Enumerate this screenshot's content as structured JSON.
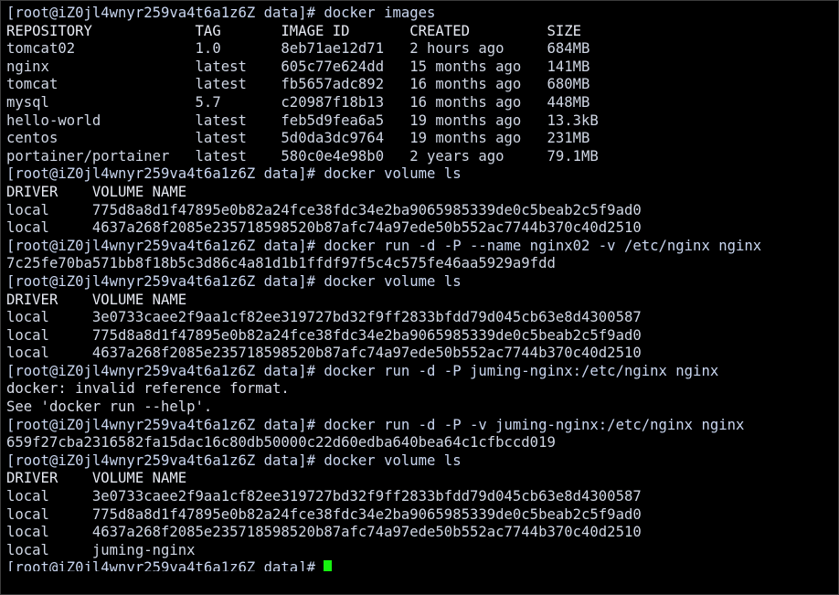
{
  "terminal": {
    "window_title": "root@iZ0jl4wnyr259va4t6a1z6Z:/data",
    "shell_prompt": "[root@iZ0jl4wnyr259va4t6a1z6Z data]# ",
    "background_color": "#000000",
    "foreground_color": "#d8dce8",
    "cursor_color": "#16f110",
    "cursor_glyph": " ",
    "lines": [
      {
        "id": "l01",
        "kind": "prompt",
        "text": "[root@iZ0jl4wnyr259va4t6a1z6Z data]# docker images"
      },
      {
        "id": "l02",
        "kind": "header",
        "text": "REPOSITORY            TAG       IMAGE ID       CREATED         SIZE"
      },
      {
        "id": "l03",
        "kind": "output",
        "text": "tomcat02              1.0       8eb71ae12d71   2 hours ago     684MB"
      },
      {
        "id": "l04",
        "kind": "output",
        "text": "nginx                 latest    605c77e624dd   15 months ago   141MB"
      },
      {
        "id": "l05",
        "kind": "output",
        "text": "tomcat                latest    fb5657adc892   16 months ago   680MB"
      },
      {
        "id": "l06",
        "kind": "output",
        "text": "mysql                 5.7       c20987f18b13   16 months ago   448MB"
      },
      {
        "id": "l07",
        "kind": "output",
        "text": "hello-world           latest    feb5d9fea6a5   19 months ago   13.3kB"
      },
      {
        "id": "l08",
        "kind": "output",
        "text": "centos                latest    5d0da3dc9764   19 months ago   231MB"
      },
      {
        "id": "l09",
        "kind": "output",
        "text": "portainer/portainer   latest    580c0e4e98b0   2 years ago     79.1MB"
      },
      {
        "id": "l10",
        "kind": "prompt",
        "text": "[root@iZ0jl4wnyr259va4t6a1z6Z data]# docker volume ls"
      },
      {
        "id": "l11",
        "kind": "header",
        "text": "DRIVER    VOLUME NAME"
      },
      {
        "id": "l12",
        "kind": "output",
        "text": "local     775d8a8d1f47895e0b82a24fce38fdc34e2ba9065985339de0c5beab2c5f9ad0"
      },
      {
        "id": "l13",
        "kind": "output",
        "text": "local     4637a268f2085e235718598520b87afc74a97ede50b552ac7744b370c40d2510"
      },
      {
        "id": "l14",
        "kind": "prompt",
        "text": "[root@iZ0jl4wnyr259va4t6a1z6Z data]# docker run -d -P --name nginx02 -v /etc/nginx nginx"
      },
      {
        "id": "l15",
        "kind": "output",
        "text": "7c25fe70ba571bb8f18b5c3d86c4a81d1b1ffdf97f5c4c575fe46aa5929a9fdd"
      },
      {
        "id": "l16",
        "kind": "prompt",
        "text": "[root@iZ0jl4wnyr259va4t6a1z6Z data]# docker volume ls"
      },
      {
        "id": "l17",
        "kind": "header",
        "text": "DRIVER    VOLUME NAME"
      },
      {
        "id": "l18",
        "kind": "output",
        "text": "local     3e0733caee2f9aa1cf82ee319727bd32f9ff2833bfdd79d045cb63e8d4300587"
      },
      {
        "id": "l19",
        "kind": "output",
        "text": "local     775d8a8d1f47895e0b82a24fce38fdc34e2ba9065985339de0c5beab2c5f9ad0"
      },
      {
        "id": "l20",
        "kind": "output",
        "text": "local     4637a268f2085e235718598520b87afc74a97ede50b552ac7744b370c40d2510"
      },
      {
        "id": "l21",
        "kind": "prompt",
        "text": "[root@iZ0jl4wnyr259va4t6a1z6Z data]# docker run -d -P juming-nginx:/etc/nginx nginx"
      },
      {
        "id": "l22",
        "kind": "error",
        "text": "docker: invalid reference format."
      },
      {
        "id": "l23",
        "kind": "error",
        "text": "See 'docker run --help'."
      },
      {
        "id": "l24",
        "kind": "prompt",
        "text": "[root@iZ0jl4wnyr259va4t6a1z6Z data]# docker run -d -P -v juming-nginx:/etc/nginx nginx"
      },
      {
        "id": "l25",
        "kind": "output",
        "text": "659f27cba2316582fa15dac16c80db50000c22d60edba640bea64c1cfbccd019"
      },
      {
        "id": "l26",
        "kind": "prompt",
        "text": "[root@iZ0jl4wnyr259va4t6a1z6Z data]# docker volume ls"
      },
      {
        "id": "l27",
        "kind": "header",
        "text": "DRIVER    VOLUME NAME"
      },
      {
        "id": "l28",
        "kind": "output",
        "text": "local     3e0733caee2f9aa1cf82ee319727bd32f9ff2833bfdd79d045cb63e8d4300587"
      },
      {
        "id": "l29",
        "kind": "output",
        "text": "local     775d8a8d1f47895e0b82a24fce38fdc34e2ba9065985339de0c5beab2c5f9ad0"
      },
      {
        "id": "l30",
        "kind": "output",
        "text": "local     4637a268f2085e235718598520b87afc74a97ede50b552ac7744b370c40d2510"
      },
      {
        "id": "l31",
        "kind": "output",
        "text": "local     juming-nginx"
      }
    ],
    "active_prompt": "[root@iZ0jl4wnyr259va4t6a1z6Z data]# ",
    "commands_entered": [
      "docker images",
      "docker volume ls",
      "docker run -d -P --name nginx02 -v /etc/nginx nginx",
      "docker volume ls",
      "docker run -d -P juming-nginx:/etc/nginx nginx",
      "docker run -d -P -v juming-nginx:/etc/nginx nginx",
      "docker volume ls"
    ],
    "images_table": {
      "columns": [
        "REPOSITORY",
        "TAG",
        "IMAGE ID",
        "CREATED",
        "SIZE"
      ],
      "rows": [
        [
          "tomcat02",
          "1.0",
          "8eb71ae12d71",
          "2 hours ago",
          "684MB"
        ],
        [
          "nginx",
          "latest",
          "605c77e624dd",
          "15 months ago",
          "141MB"
        ],
        [
          "tomcat",
          "latest",
          "fb5657adc892",
          "16 months ago",
          "680MB"
        ],
        [
          "mysql",
          "5.7",
          "c20987f18b13",
          "16 months ago",
          "448MB"
        ],
        [
          "hello-world",
          "latest",
          "feb5d9fea6a5",
          "19 months ago",
          "13.3kB"
        ],
        [
          "centos",
          "latest",
          "5d0da3dc9764",
          "19 months ago",
          "231MB"
        ],
        [
          "portainer/portainer",
          "latest",
          "580c0e4e98b0",
          "2 years ago",
          "79.1MB"
        ]
      ]
    },
    "volume_tables": [
      {
        "columns": [
          "DRIVER",
          "VOLUME NAME"
        ],
        "rows": [
          [
            "local",
            "775d8a8d1f47895e0b82a24fce38fdc34e2ba9065985339de0c5beab2c5f9ad0"
          ],
          [
            "local",
            "4637a268f2085e235718598520b87afc74a97ede50b552ac7744b370c40d2510"
          ]
        ]
      },
      {
        "columns": [
          "DRIVER",
          "VOLUME NAME"
        ],
        "rows": [
          [
            "local",
            "3e0733caee2f9aa1cf82ee319727bd32f9ff2833bfdd79d045cb63e8d4300587"
          ],
          [
            "local",
            "775d8a8d1f47895e0b82a24fce38fdc34e2ba9065985339de0c5beab2c5f9ad0"
          ],
          [
            "local",
            "4637a268f2085e235718598520b87afc74a97ede50b552ac7744b370c40d2510"
          ]
        ]
      },
      {
        "columns": [
          "DRIVER",
          "VOLUME NAME"
        ],
        "rows": [
          [
            "local",
            "3e0733caee2f9aa1cf82ee319727bd32f9ff2833bfdd79d045cb63e8d4300587"
          ],
          [
            "local",
            "775d8a8d1f47895e0b82a24fce38fdc34e2ba9065985339de0c5beab2c5f9ad0"
          ],
          [
            "local",
            "4637a268f2085e235718598520b87afc74a97ede50b552ac7744b370c40d2510"
          ],
          [
            "local",
            "juming-nginx"
          ]
        ]
      }
    ],
    "container_ids": [
      "7c25fe70ba571bb8f18b5c3d86c4a81d1b1ffdf97f5c4c575fe46aa5929a9fdd",
      "659f27cba2316582fa15dac16c80db50000c22d60edba640bea64c1cfbccd019"
    ],
    "errors": [
      "docker: invalid reference format.",
      "See 'docker run --help'."
    ]
  }
}
